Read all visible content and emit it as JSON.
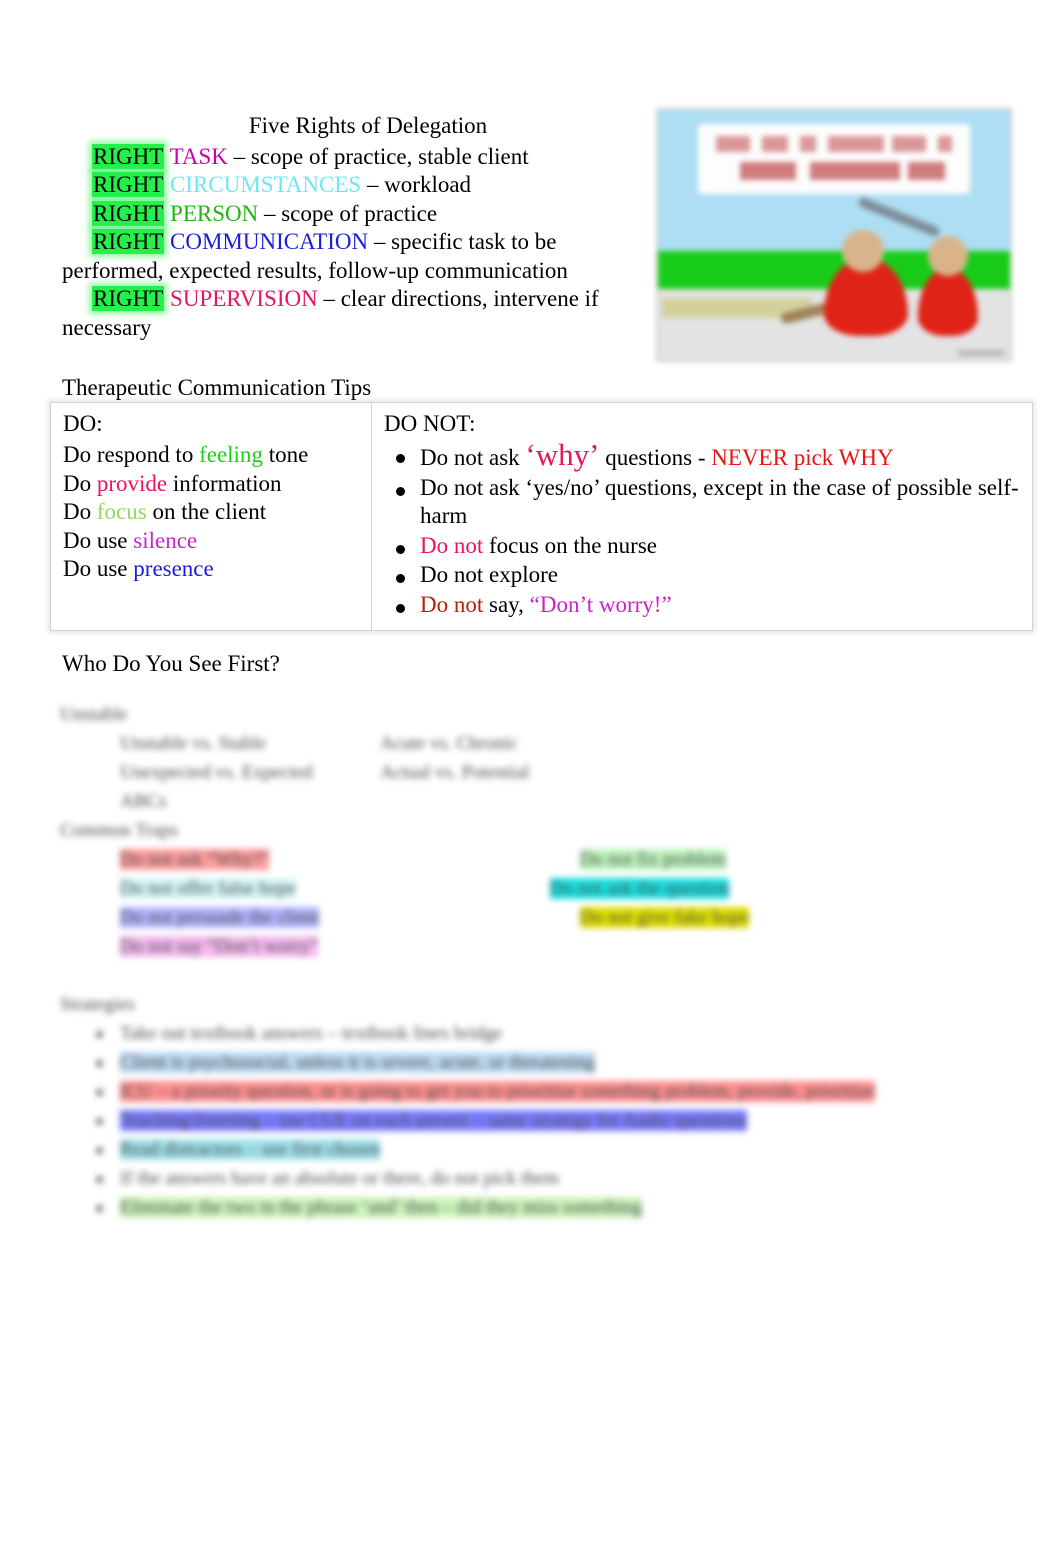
{
  "document": {
    "title": "Five Rights of Delegation"
  },
  "delegation": {
    "title": "Five Rights of Delegation",
    "rights": [
      {
        "right": "RIGHT",
        "key": "TASK",
        "color": "#cc00a8",
        "desc": " – scope of practice, stable client"
      },
      {
        "right": "RIGHT",
        "key": "CIRCUMSTANCES",
        "color": "#6fe6f7",
        "desc": " – workload"
      },
      {
        "right": "RIGHT",
        "key": "PERSON",
        "color": "#22b512",
        "desc": " – scope of practice"
      },
      {
        "right": "RIGHT",
        "key": "COMMUNICATION",
        "color": "#1b1bdd",
        "desc": " – specific task to be"
      },
      {
        "right": "RIGHT",
        "key": "SUPERVISION",
        "color": "#e8145e",
        "desc": " – clear directions, intervene if"
      }
    ],
    "wrap_line_communication": "performed, expected results, follow-up communication",
    "wrap_line_supervision": "necessary",
    "highlight_color": "#00f036"
  },
  "clipart": {
    "name": "delegation-cartoon-illustration",
    "sky_color": "#addef3",
    "grass_color": "#19cc19",
    "ground_color": "#e3e3e3",
    "figure_color": "#e02318"
  },
  "tips": {
    "heading": "Therapeutic Communication Tips",
    "do": {
      "header": "DO:",
      "items": [
        {
          "pre": "Do respond to ",
          "hl": "feeling",
          "hl_class": "c-feeling",
          "post": " tone"
        },
        {
          "pre": "Do ",
          "hl": "provide",
          "hl_class": "c-provide",
          "post": " information"
        },
        {
          "pre": "Do ",
          "hl": "focus",
          "hl_class": "c-focus",
          "post": " on the client"
        },
        {
          "pre": "Do use ",
          "hl": "silence",
          "hl_class": "c-silence",
          "post": ""
        },
        {
          "pre": "Do use ",
          "hl": "presence",
          "hl_class": "c-presence",
          "post": ""
        }
      ]
    },
    "donot": {
      "header": "DO NOT:",
      "items": [
        {
          "seg1": "Do not ask ",
          "why": "‘why’",
          "seg2": " questions -  ",
          "never": "NEVER pick WHY"
        },
        {
          "plain": "Do not ask ‘yes/no’ questions, except in the case of possible self-harm"
        },
        {
          "accent": "Do not",
          "accent_class": "c-donot-p",
          "rest": " focus on the nurse"
        },
        {
          "plain": "Do not explore"
        },
        {
          "accent": "Do not",
          "accent_class": "c-donot-r",
          "rest": "  say, ",
          "quote": "“Don’t worry!”"
        }
      ]
    }
  },
  "who_first": {
    "heading": "Who Do You See First?",
    "obscured_note": "blurred-content",
    "sections": [
      {
        "label": "Unstable",
        "rows": [
          {
            "left": "Unstable vs. Stable",
            "right": "Acute vs. Chronic"
          },
          {
            "left": "Unexpected vs. Expected",
            "right": "Actual vs. Potential"
          },
          {
            "left": "ABCs",
            "right": ""
          }
        ]
      },
      {
        "label": "Common Traps",
        "rows": [
          {
            "left": "Do not ask “Why?”",
            "right": "Do not fix problem"
          },
          {
            "left": "Do not offer false hope",
            "right": "Do not ask the question"
          },
          {
            "left": "Do not persuade the client",
            "right": "Do not give fake hope"
          },
          {
            "left": "Do not say “Don’t worry”",
            "right": ""
          }
        ]
      },
      {
        "label": "Strategies",
        "rows": [
          {
            "left": "Take out textbook answers – textbook lines bridge",
            "right": ""
          },
          {
            "left": "Client is psychosocial, unless it is severe, acute, or threatening",
            "right": ""
          },
          {
            "left": "ICU – a priority question, or is going to get you to prioritize something problem, provide, prioritize",
            "right": ""
          },
          {
            "left": "Teaching/listening – use CUE on each answer – same strategy for Audio questions",
            "right": ""
          },
          {
            "left": "Read distractors – use first chosen",
            "right": ""
          },
          {
            "left": "If the answers have an absolute or there, do not pick them",
            "right": ""
          },
          {
            "left": "Eliminate the two in the phrase ‘and’ then – did they miss something",
            "right": ""
          }
        ]
      }
    ]
  }
}
